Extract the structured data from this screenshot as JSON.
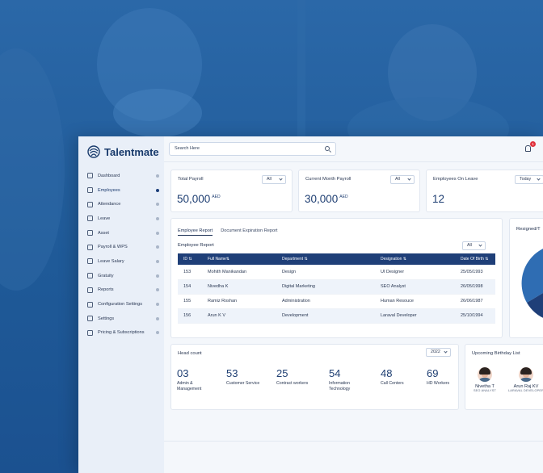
{
  "brand": {
    "name": "Talentmate",
    "accent": "#1f3f78"
  },
  "search": {
    "placeholder": "Search Here"
  },
  "notifications": {
    "count": "1"
  },
  "sidebar": {
    "items": [
      {
        "label": "Dashboard",
        "icon": "dashboard-icon"
      },
      {
        "label": "Employees",
        "icon": "employees-icon",
        "active": true
      },
      {
        "label": "Attendance",
        "icon": "calendar-icon"
      },
      {
        "label": "Leave",
        "icon": "leave-icon"
      },
      {
        "label": "Asset",
        "icon": "laptop-icon"
      },
      {
        "label": "Payroll & WPS",
        "icon": "payroll-icon"
      },
      {
        "label": "Leave Salary",
        "icon": "wallet-icon"
      },
      {
        "label": "Gratuity",
        "icon": "crown-icon"
      },
      {
        "label": "Reports",
        "icon": "reports-icon"
      },
      {
        "label": "Configuration Settings",
        "icon": "config-icon"
      },
      {
        "label": "Settings",
        "icon": "gear-icon"
      },
      {
        "label": "Pricing & Subscriptions",
        "icon": "card-icon"
      }
    ]
  },
  "kpis": {
    "total_payroll": {
      "title": "Total Payroll",
      "filter": "All",
      "value": "50,000",
      "unit": "AED"
    },
    "current_month_payroll": {
      "title": "Current Month Payroll",
      "filter": "All",
      "value": "30,000",
      "unit": "AED"
    },
    "employees_on_leave": {
      "title": "Employees On Leave",
      "filter": "Today",
      "value": "12"
    }
  },
  "report": {
    "tabs": [
      "Employee Report",
      "Document Expiration Report"
    ],
    "section_title": "Employee Report",
    "filter": "All",
    "columns": [
      "ID",
      "Full Name",
      "Department",
      "Designation",
      "Date Of Birth"
    ],
    "rows": [
      [
        "153",
        "Mohith Manikandan",
        "Design",
        "UI Designer",
        "25/05/1993"
      ],
      [
        "154",
        "Nivedha K",
        "Digital Marketing",
        "SEO Analyst",
        "26/05/1998"
      ],
      [
        "155",
        "Ramiz Roshan",
        "Administration",
        "Human Resouce",
        "26/06/1987"
      ],
      [
        "156",
        "Arun K V",
        "Development",
        "Laraval Developer",
        "25/10/1994"
      ]
    ]
  },
  "resigned": {
    "title": "Resigned/T"
  },
  "headcount": {
    "title": "Head count",
    "year": "2022",
    "items": [
      {
        "value": "03",
        "label": "Admin & Management"
      },
      {
        "value": "53",
        "label": "Customer Service"
      },
      {
        "value": "25",
        "label": "Contract workers"
      },
      {
        "value": "54",
        "label": "Information Technology"
      },
      {
        "value": "48",
        "label": "Call Centers"
      },
      {
        "value": "69",
        "label": "HD Workers"
      }
    ]
  },
  "birthdays": {
    "title": "Upcoming Birthday List",
    "people": [
      {
        "name": "Nivetha T",
        "role": "SEO ANALYST"
      },
      {
        "name": "Arun Raj KV",
        "role": "LARAVAL DEVELOPER"
      }
    ]
  }
}
